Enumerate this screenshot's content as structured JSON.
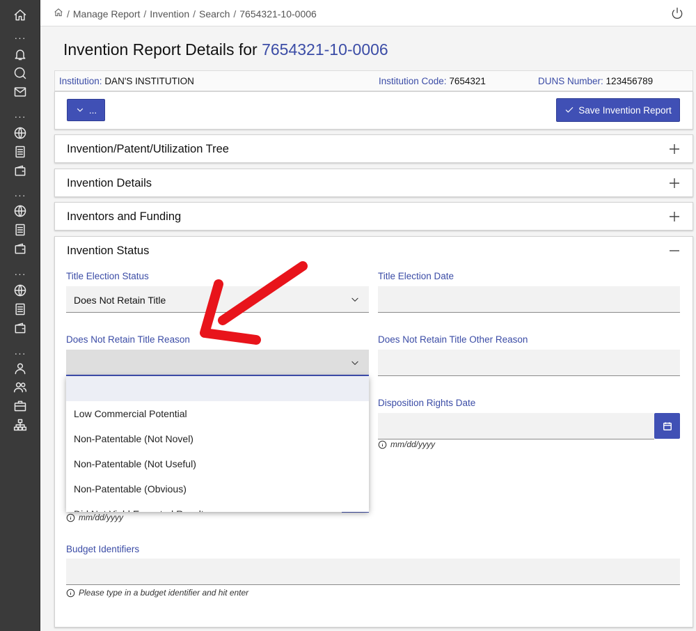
{
  "breadcrumb": {
    "items": [
      "Manage Report",
      "Invention",
      "Search",
      "7654321-10-0006"
    ]
  },
  "page": {
    "title_prefix": "Invention Report Details for",
    "title_id": "7654321-10-0006"
  },
  "info": {
    "institution_label": "Institution:",
    "institution_value": "DAN'S INSTITUTION",
    "code_label": "Institution Code:",
    "code_value": "7654321",
    "duns_label": "DUNS Number:",
    "duns_value": "123456789"
  },
  "actions": {
    "menu_label": "...",
    "save_label": "Save Invention Report"
  },
  "panels": {
    "tree": "Invention/Patent/Utilization Tree",
    "details": "Invention Details",
    "inventors": "Inventors and Funding",
    "status": "Invention Status"
  },
  "status_form": {
    "title_election_status_label": "Title Election Status",
    "title_election_status_value": "Does Not Retain Title",
    "title_election_date_label": "Title Election Date",
    "title_election_date_value": "",
    "reason_label": "Does Not Retain Title Reason",
    "reason_value": "",
    "other_reason_label": "Does Not Retain Title Other Reason",
    "other_reason_value": "",
    "disposition_date_label": "Disposition Rights Date",
    "disposition_date_value": "",
    "date_hint": "mm/dd/yyyy",
    "left_date_hint": "mm/dd/yyyy",
    "budget_label": "Budget Identifiers",
    "budget_value": "",
    "budget_hint": "Please type in a budget identifier and hit enter"
  },
  "reason_options": [
    "",
    "Low Commercial Potential",
    "Non-Patentable (Not Novel)",
    "Non-Patentable (Not Useful)",
    "Non-Patentable (Obvious)",
    "Did Not Yield Expected Results"
  ],
  "colors": {
    "accent": "#4050b5",
    "label_blue": "#3b4ca6",
    "sidebar": "#3a3a3a",
    "annotation_arrow": "#e8141b"
  }
}
